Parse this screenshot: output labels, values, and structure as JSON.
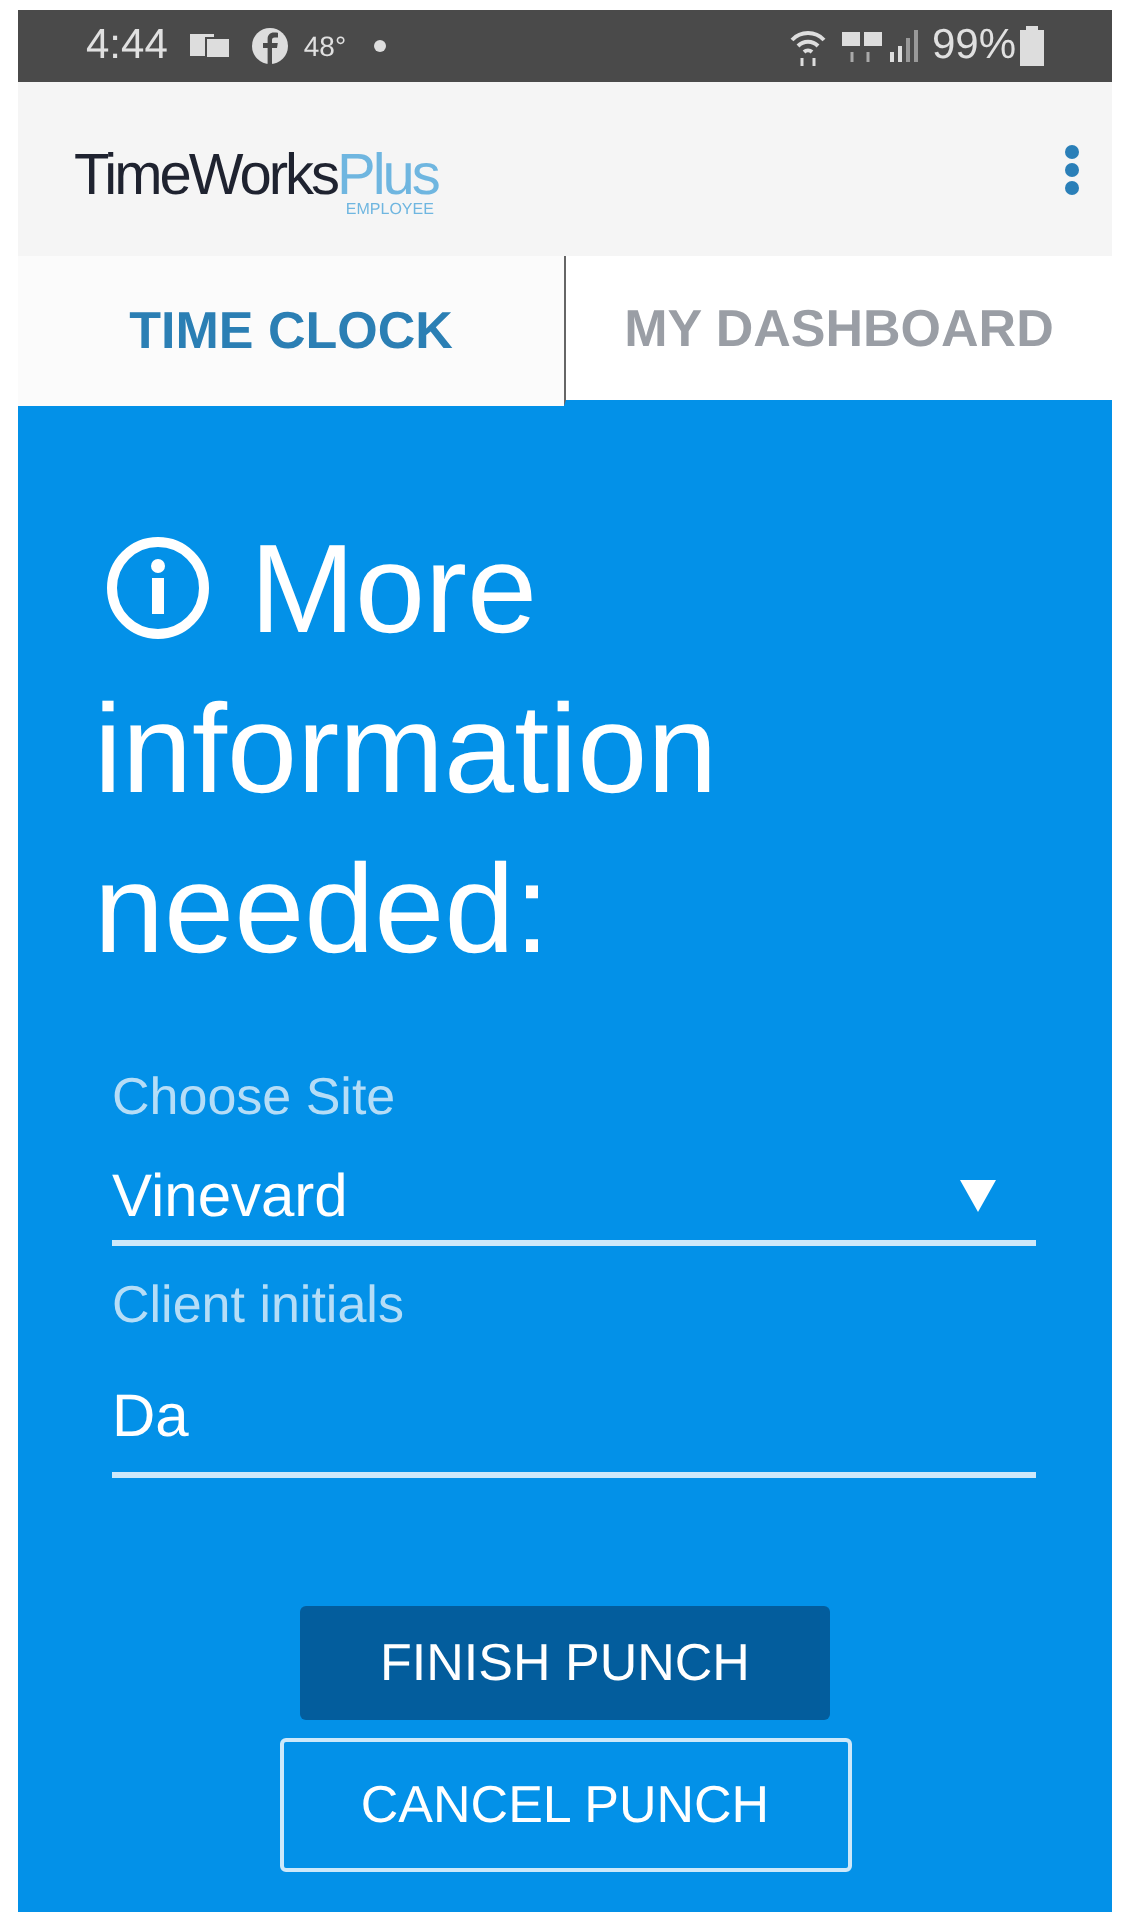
{
  "status_bar": {
    "time": "4:44",
    "temperature": "48°",
    "battery": "99%"
  },
  "app_bar": {
    "logo": {
      "name": "TimeWorks",
      "suffix": "Plus",
      "tagline": "EMPLOYEE"
    }
  },
  "tabs": [
    {
      "label": "TIME CLOCK",
      "selected": true
    },
    {
      "label": "MY DASHBOARD",
      "selected": false
    }
  ],
  "form": {
    "heading": "More information needed:",
    "fields": [
      {
        "kind": "dropdown",
        "label": "Choose Site",
        "value": "Vinevard"
      },
      {
        "kind": "text",
        "label": "Client initials",
        "value": "Da"
      }
    ],
    "buttons": [
      {
        "kind": "primary",
        "label": "FINISH PUNCH"
      },
      {
        "kind": "outline",
        "label": "CANCEL PUNCH"
      }
    ]
  }
}
